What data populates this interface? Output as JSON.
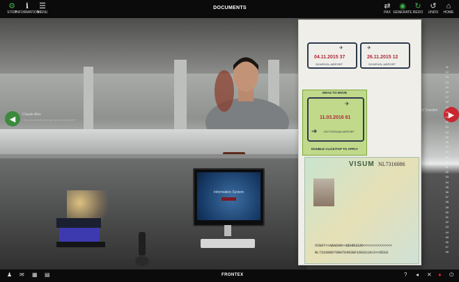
{
  "window": {
    "title": "DOCUMENTS"
  },
  "toolbar_left": [
    {
      "label": "STOP",
      "icon": "gear-icon"
    },
    {
      "label": "INFORMATION",
      "icon": "info-icon"
    },
    {
      "label": "MENU",
      "icon": "menu-icon"
    }
  ],
  "toolbar_right": [
    {
      "label": "PAX",
      "icon": "swap-icon"
    },
    {
      "label": "GENERATE",
      "icon": "eye-icon"
    },
    {
      "label": "REDO",
      "icon": "refresh-icon"
    },
    {
      "label": "UNDO",
      "icon": "undo-icon"
    },
    {
      "label": "HOME",
      "icon": "home-icon"
    }
  ],
  "scene": {
    "left_nav_text": "Claude Alex",
    "left_nav_sub": "Can you explain why you are coming here?",
    "right_nav_text": "Next Traveller",
    "monitor_title": "Information System",
    "monitor_button": "LOGIN"
  },
  "document": {
    "stamps": [
      {
        "date": "04.11.2015  37",
        "airport": "SCHIPHOL AIRPORT"
      },
      {
        "date": "26.11.2015  12",
        "airport": "SCHIPHOL AIRPORT"
      },
      {
        "date": "11.03.2016  61",
        "airport": "ROTTERDAM AIRPORT"
      }
    ],
    "drag_to_move": "DRAG TO MOVE",
    "double_click": "DOUBLE CLICK/TAP TO APPLY",
    "visa_word": "VISUM",
    "visa_number": "NL7316086",
    "mrz_line1": "VCNAT<<ABADAN<<BEHRUSUN<<<<<<<<<<<<<<",
    "mrz_line2": "NL7316886?SRAT6403GF1603119<2<<0519"
  },
  "side_numbers": [
    "11",
    "12",
    "13",
    "14",
    "15",
    "16",
    "17",
    "18",
    "19",
    "20",
    "21",
    "22",
    "23",
    "24",
    "25",
    "26",
    "27",
    "28",
    "29",
    "30",
    "31",
    "32",
    "33",
    "34",
    "35",
    "36",
    "37",
    "38",
    "39",
    "40",
    "41",
    "42",
    "43",
    "44",
    "45",
    "46",
    "47",
    "48"
  ],
  "bottom_left": [
    {
      "label": "PERSON",
      "icon": "person-icon"
    },
    {
      "label": "CHAT",
      "icon": "chat-icon"
    },
    {
      "label": "CALC",
      "icon": "calculator-icon"
    },
    {
      "label": "NOTES",
      "icon": "notes-icon"
    }
  ],
  "bottom_center": "FRONTEX",
  "bottom_right": [
    {
      "label": "?",
      "icon": "help-icon"
    },
    {
      "label": "VOL",
      "icon": "volume-icon"
    },
    {
      "label": "FULL",
      "icon": "fullscreen-icon"
    },
    {
      "label": "REC",
      "icon": "stop-icon"
    },
    {
      "label": "EXIT",
      "icon": "exit-icon"
    }
  ],
  "colors": {
    "accent_green": "#3cb34a",
    "accent_red": "#c9262f",
    "bar_bg": "#0b0b0b"
  }
}
